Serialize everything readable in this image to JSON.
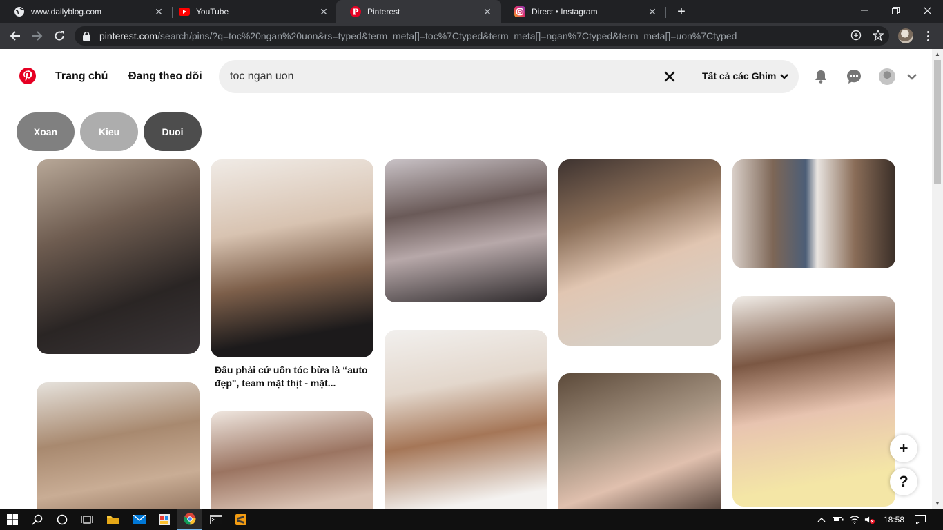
{
  "browser": {
    "tabs": [
      {
        "title": "www.dailyblog.com",
        "icon": "globe-icon"
      },
      {
        "title": "YouTube",
        "icon": "youtube-icon"
      },
      {
        "title": "Pinterest",
        "icon": "pinterest-icon",
        "active": true
      },
      {
        "title": "Direct • Instagram",
        "icon": "instagram-icon"
      }
    ],
    "url_host": "pinterest.com",
    "url_path": "/search/pins/?q=toc%20ngan%20uon&rs=typed&term_meta[]=toc%7Ctyped&term_meta[]=ngan%7Ctyped&term_meta[]=uon%7Ctyped"
  },
  "header": {
    "nav": [
      "Trang chủ",
      "Đang theo dõi"
    ],
    "search_value": "toc ngan uon",
    "scope_label": "Tất cả các Ghim"
  },
  "chips": [
    {
      "label": "Xoan",
      "color": "#808080"
    },
    {
      "label": "Kieu",
      "color": "#adadad"
    },
    {
      "label": "Duoi",
      "color": "#4d4d4d"
    }
  ],
  "pins": {
    "caption": "Đâu phải cứ uốn tóc bừa là “auto đẹp\", team mặt thịt - mặt..."
  },
  "fab": {
    "add": "+",
    "help": "?"
  },
  "taskbar": {
    "time": "18:58"
  },
  "colors": {
    "pinterest_red": "#e60023",
    "chrome_dark": "#202124",
    "chrome_toolbar": "#35363a"
  }
}
